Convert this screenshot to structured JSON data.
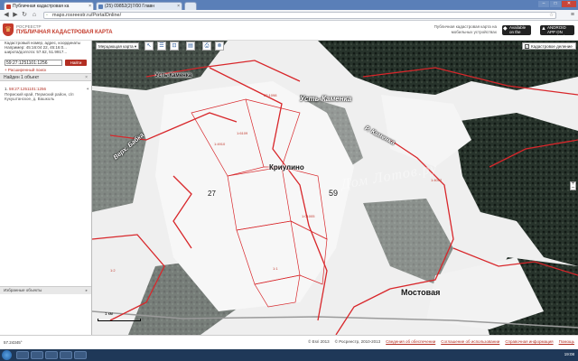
{
  "browser": {
    "tabs": [
      {
        "label": "Публичная кадастровая ка",
        "active": true,
        "favicon_color": "#c43b2c"
      },
      {
        "label": "(25) 09852(2)7/00 Главн",
        "active": false,
        "favicon_color": "#5a7fb8"
      },
      {
        "label": "",
        "active": false,
        "favicon_color": "#ffffff"
      }
    ],
    "url": "maps.rosreestr.ru/PortalOnline/",
    "window_buttons": [
      "–",
      "□",
      "✕"
    ]
  },
  "site": {
    "org_line": "РОСРЕЕСТР",
    "title": "ПУБЛИЧНАЯ КАДАСТРОВАЯ КАРТА",
    "app_promo": "Публичная кадастровая карта на мобильных устройствах",
    "appstore": {
      "top": "Available on the",
      "name": "App Store"
    },
    "googleplay": {
      "top": "ANDROID APP ON",
      "name": "Google play"
    }
  },
  "left_panel": {
    "help_lines": [
      "Кадастровый номер, адрес, координаты",
      "Например: 45:16:04 22, 45:16:0...",
      "широта/долгота: 57.62, 51.9917..."
    ],
    "search_value": "59:27:1251101:1256",
    "find_button": "Найти",
    "advanced_link": "+ Расширенный поиск",
    "found_header": "Найден 1 объект",
    "result": {
      "index": "1.",
      "cad_number": "59:27:1251101:1256",
      "description": "Пермский край, Пермский район, с/п Кукуштанское, д. Вашколь"
    },
    "bottom_label": "Избранные объекты"
  },
  "map": {
    "toolbar": {
      "basemap_select": "Мерцающая карта",
      "tools": [
        "select-icon",
        "layers-icon",
        "measure-icon",
        "bookmark-icon",
        "print-icon",
        "link-icon"
      ],
      "legend_check": "Легенда",
      "theme_select": "Кадастровое деление"
    },
    "labels": {
      "ust_kamenka_1": "Усть-Каменка",
      "ust_kamenka_2": "Усть-Каменка",
      "kamenka_river": "Р. Каменка",
      "verkh_babka": "Верх. Бабка",
      "krivulino": "Криулино",
      "mostovaya": "Мостовая",
      "num_27": "27",
      "num_59": "59",
      "watermark": "Дом Лотов.ру"
    },
    "cad_labels": [
      "22:1098",
      "1:4910",
      "1:6109",
      "1:01005",
      "1:4002",
      "1:1",
      "1:2"
    ],
    "scale_label": "1 км",
    "colors": {
      "boundary": "#d8262a",
      "forest": "#1f2a24",
      "snow": "#f3f3f3"
    }
  },
  "footer": {
    "coords": "57.24345°",
    "copyright": "© Esri 2013",
    "links": [
      "© Росреестр, 2010-2013",
      "Сведения об обеспечении",
      "Соглашение об использовании",
      "Справочная информация"
    ],
    "help": "Помощь"
  },
  "taskbar": {
    "time": "19:08"
  }
}
